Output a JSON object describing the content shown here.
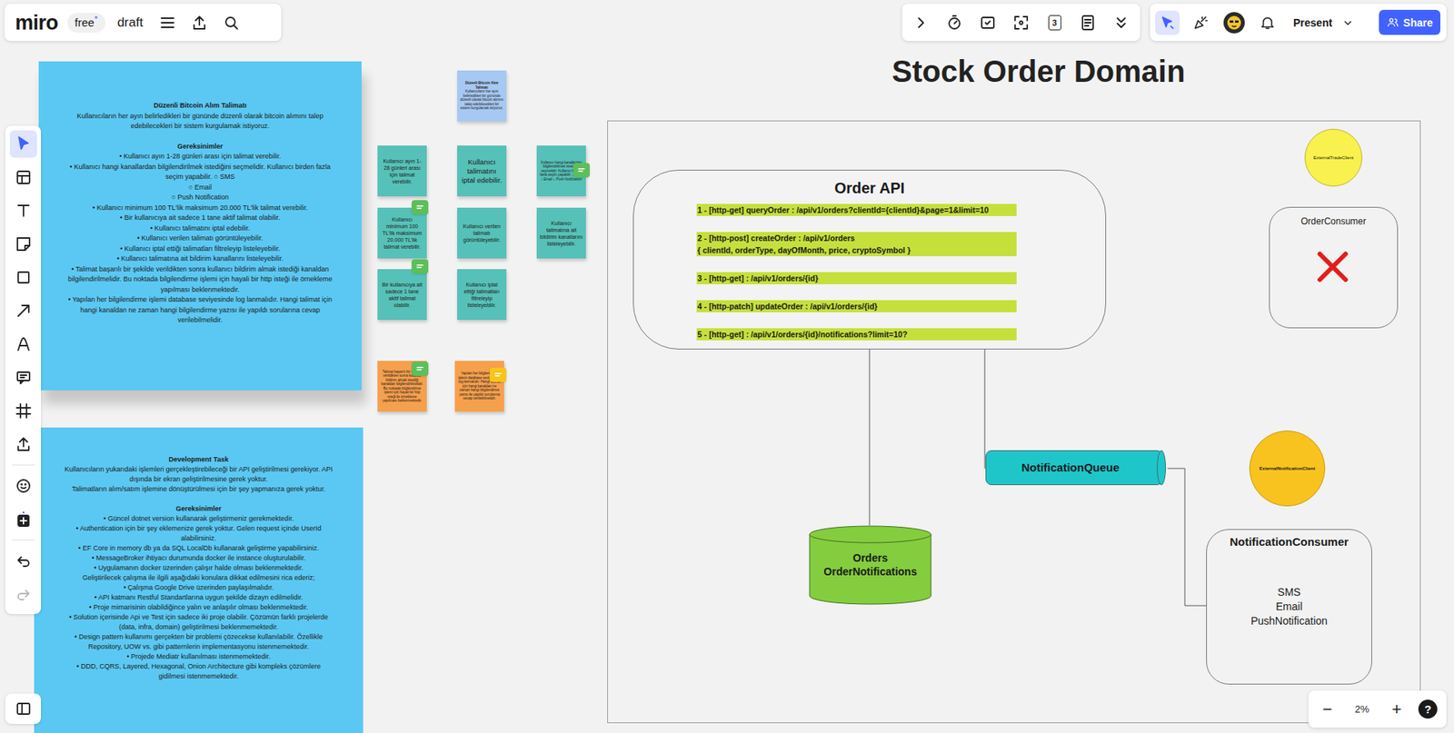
{
  "topbar": {
    "logo": "miro",
    "plan": "free",
    "plan_mark": "*",
    "board_name": "draft"
  },
  "toolbar_left_actions": [
    {
      "kind": "menu"
    },
    {
      "kind": "upload"
    },
    {
      "kind": "search"
    }
  ],
  "toolbar_right": [
    {
      "kind": "chevron-right",
      "label": ""
    },
    {
      "kind": "timer",
      "label": ""
    },
    {
      "kind": "reactions",
      "label": ""
    },
    {
      "kind": "focus",
      "label": ""
    },
    {
      "kind": "counter",
      "label": "3"
    },
    {
      "kind": "notes",
      "label": ""
    },
    {
      "kind": "chevrons-down",
      "label": ""
    }
  ],
  "collab_bar": {
    "tools": [
      {
        "kind": "select",
        "selected": true
      },
      {
        "kind": "party",
        "selected": false
      },
      {
        "kind": "avatar",
        "selected": false
      },
      {
        "kind": "bell",
        "selected": false
      }
    ],
    "present": "Present",
    "share": "Share"
  },
  "left_tools": [
    {
      "kind": "cursor",
      "selected": true,
      "disabled": false
    },
    {
      "kind": "layout",
      "selected": false,
      "disabled": false
    },
    {
      "kind": "text",
      "selected": false,
      "disabled": false
    },
    {
      "kind": "sticky",
      "selected": false,
      "disabled": false
    },
    {
      "kind": "shape",
      "selected": false,
      "disabled": false
    },
    {
      "kind": "arrow",
      "selected": false,
      "disabled": false
    },
    {
      "kind": "pen",
      "selected": false,
      "disabled": false
    },
    {
      "kind": "comment",
      "selected": false,
      "disabled": false
    },
    {
      "kind": "frame",
      "selected": false,
      "disabled": false
    },
    {
      "kind": "upload",
      "selected": false,
      "disabled": false
    },
    {
      "kind": "sticker",
      "selected": false,
      "disabled": false
    },
    {
      "kind": "more",
      "selected": false,
      "disabled": false
    },
    {
      "kind": "undo",
      "selected": false,
      "disabled": false
    },
    {
      "kind": "redo",
      "selected": false,
      "disabled": true
    }
  ],
  "zoom": {
    "minus": "−",
    "level": "2%",
    "plus": "+",
    "help": "?"
  },
  "canvas": {
    "title": "Stock Order Domain",
    "requirements": {
      "blocks": [
        {
          "kind": "heading",
          "text": "Düzenli Bitcoin Alım Talimatı"
        },
        {
          "kind": "para",
          "text": "Kullanıcıların her ayın belirledikleri bir gününde düzenli olarak bitcoin alımını talep edebilecekleri bir sistem kurgulamak istiyoruz."
        },
        {
          "kind": "heading",
          "text": "Gereksinimler"
        },
        {
          "kind": "para",
          "text": "• Kullanıcı ayın 1-28 günleri arası için talimat verebilir."
        },
        {
          "kind": "para",
          "text": "• Kullanıcı hangi kanallardan bilgilendirilmek istediğini seçmelidir. Kullanıcı birden fazla seçim yapabilir. ○ SMS"
        },
        {
          "kind": "para",
          "text": "○ Email"
        },
        {
          "kind": "para",
          "text": "○ Push Notification"
        },
        {
          "kind": "para",
          "text": "• Kullanıcı minimum 100 TL'lik maksimum 20.000 TL'lik talimat verebilir."
        },
        {
          "kind": "para",
          "text": "• Bir kullanıcıya ait sadece 1 tane aktif talimat olabilir."
        },
        {
          "kind": "para",
          "text": "• Kullanıcı talimatını iptal edebilir."
        },
        {
          "kind": "para",
          "text": "• Kullanıcı verilen talimatı görüntüleyebilir."
        },
        {
          "kind": "para",
          "text": "• Kullanıcı iptal ettiği talimatları filtreleyip listeleyebilir."
        },
        {
          "kind": "para",
          "text": "• Kullanıcı talimatına ait bildirim kanallarını listeleyebilir."
        },
        {
          "kind": "para",
          "text": "• Talimat başarılı bir şekilde verildikten sonra kullanıcı bildirim almak istediği kanaldan bilgilendirilmelidir. Bu noktada bilgilendirme işlemi için hayali bir http isteği ile örnekleme yapılması beklenmektedir."
        },
        {
          "kind": "para",
          "text": "• Yapılan her bilgilendirme işlemi database seviyesinde log lanmalıdır. Hangi talimat için hangi kanaldan ne zaman hangi bilgilendirme yazısı ile yapıldı sorularına cevap verilebilmelidir."
        }
      ]
    },
    "development_task": {
      "blocks": [
        {
          "kind": "heading",
          "text": "Development Task"
        },
        {
          "kind": "para",
          "text": "Kullanıcıların yukarıdaki işlemleri gerçekleştirebileceği bir API geliştirilmesi gerekiyor. API dışında bir ekran geliştirilmesine gerek yoktur."
        },
        {
          "kind": "para",
          "text": "Talimatların alım/satım işlemine dönüştürülmesi için bir şey yapmanıza gerek yoktur."
        },
        {
          "kind": "heading",
          "text": "Gereksinimler"
        },
        {
          "kind": "para",
          "text": "• Güncel dotnet version kullanarak geliştirmeniz gerekmektedir."
        },
        {
          "kind": "para",
          "text": "• Authentication için bir şey eklemenize gerek yoktur. Gelen request içinde UserId alabilirsiniz."
        },
        {
          "kind": "para",
          "text": "• EF Core in memory db ya da SQL LocalDb kullanarak geliştirme yapabilirsiniz."
        },
        {
          "kind": "para",
          "text": "• MessageBroker ihtiyacı durumunda docker ile instance oluşturulabilir."
        },
        {
          "kind": "para",
          "text": "• Uygulamanın docker üzerinden çalışır halde olması beklenmektedir."
        },
        {
          "kind": "para",
          "text": "Geliştirilecek çalışma ile ilgili aşağıdaki konulara dikkat edilmesini rica ederiz;"
        },
        {
          "kind": "para",
          "text": "• Çalışma Google Drive üzerinden paylaşılmalıdır."
        },
        {
          "kind": "para",
          "text": "• API katmanı Restful Standartlarına uygun şekilde dizayn edilmelidir."
        },
        {
          "kind": "para",
          "text": "• Proje mimarisinin olabildiğince yalın ve anlaşılır olması beklenmektedir."
        },
        {
          "kind": "para",
          "text": "• Solution içerisinde Api ve Test için sadece iki proje olabilir. Çözümün farklı projelerde (data, infra, domain) geliştirilmesi beklenmemektedir."
        },
        {
          "kind": "para",
          "text": "• Design pattern kullanımı gerçekten bir problemi çözecekse kullanılabilir. Özellikle Repository, UOW vs. gibi patternlerin implementasyonu istenmemektedir."
        },
        {
          "kind": "para",
          "text": "• Projede Mediatr kullanılması istenmemektedir."
        },
        {
          "kind": "para",
          "text": "• DDD, CQRS, Layered, Hexagonal, Onion Architecture gibi kompleks çözümlere gidilmesi istenmemektedir."
        }
      ]
    },
    "stickies": [
      {
        "color": "#a7c8f2",
        "title": "Düzenli Bitcoin Alım Talimatı",
        "text": "Kullanıcıların her ayın belirledikleri bir gününde düzenli olarak bitcoin alımını talep edebilecekleri bir sistem kurgulamak istiyoruz.",
        "comment": false,
        "comment_color": ""
      },
      {
        "color": "#56c1b8",
        "title": "",
        "text": "Kullanıcı ayın 1-28 günleri arası için talimat verebilir.",
        "comment": false,
        "comment_color": ""
      },
      {
        "color": "#56c1b8",
        "title": "",
        "text": "Kullanıcı talimatını iptal edebilir.",
        "comment": false,
        "comment_color": ""
      },
      {
        "color": "#56c1b8",
        "title": "",
        "text": "Kullanıcı hangi kanallardan bilgilendirilmek istediğini seçmelidir. Kullanıcı birden fazla seçim yapabilir. ○ SMS ○ Email ○ Push Notification",
        "comment": true,
        "comment_color": "#5cbf5a"
      },
      {
        "color": "#56c1b8",
        "title": "",
        "text": "Kullanıcı minimum 100 TL'lik maksimum 20.000 TL'lik talimat verebilir.",
        "comment": true,
        "comment_color": "#5cbf5a"
      },
      {
        "color": "#56c1b8",
        "title": "",
        "text": "Kullanıcı verilen talimatı görüntüleyebilir.",
        "comment": false,
        "comment_color": ""
      },
      {
        "color": "#56c1b8",
        "title": "",
        "text": "Kullanıcı talimatına ait bildirim kanallarını listeleyebilir.",
        "comment": false,
        "comment_color": ""
      },
      {
        "color": "#56c1b8",
        "title": "",
        "text": "Bir kullanıcıya ait sadece 1 tane aktif talimat olabilir.",
        "comment": true,
        "comment_color": "#5cbf5a"
      },
      {
        "color": "#56c1b8",
        "title": "",
        "text": "Kullanıcı iptal ettiği talimatları filtreleyip listeleyebilir.",
        "comment": false,
        "comment_color": ""
      },
      {
        "color": "#f6a04d",
        "title": "",
        "text": "Talimat başarılı bir şekilde verildikten sonra kullanıcı bildirim almak istediği kanaldan bilgilendirilmelidir. Bu noktada bilgilendirme işlemi için hayali bir http isteği ile örnekleme yapılması beklenmektedir.",
        "comment": true,
        "comment_color": "#5cbf5a"
      },
      {
        "color": "#f6a04d",
        "title": "",
        "text": "Yapılan her bilgilendirme işlemi database seviyesinde log lanmalıdır. Hangi talimat için hangi kanaldan ne zaman hangi bilgilendirme yazısı ile yapıldı sorularına cevap verilebilmelidir.",
        "comment": true,
        "comment_color": "#f5c518"
      }
    ],
    "order_api": {
      "title": "Order API",
      "endpoints": [
        "1 - [http-get] queryOrder : /api/v1/orders?clientId={clientId}&page=1&limit=10",
        "2 - [http-post] createOrder : /api/v1/orders\n{ clientId, orderType, dayOfMonth, price, cryptoSymbol }",
        "3 - [http-get] : /api/v1/orders/{id}",
        "4 - [http-patch] updateOrder : /api/v1/orders/{id}",
        "5 - [http-get] : /api/v1/orders/{id}/notifications?limit=10?"
      ]
    },
    "external_trade_client": "ExternalTradeClient",
    "order_consumer": {
      "title": "OrderConsumer",
      "disabled": true
    },
    "notification_queue": "NotificationQueue",
    "external_notification_client": "ExternalNotificationClient",
    "notification_consumer": {
      "title": "NotificationConsumer",
      "channels": [
        "SMS",
        "Email",
        "PushNotification"
      ]
    },
    "database": {
      "tables": [
        "Orders",
        "OrderNotifications"
      ]
    }
  }
}
